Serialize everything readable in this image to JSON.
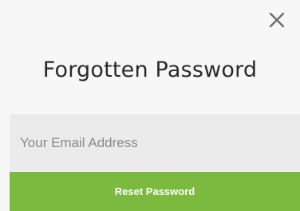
{
  "modal": {
    "close_icon": "close-icon",
    "title": "Forgotten Password",
    "email_placeholder": "Your Email Address",
    "email_value": "",
    "submit_label": "Reset Password"
  },
  "colors": {
    "accent_green": "#7cba3f",
    "modal_background": "#f7f7f7",
    "input_background": "#ebebeb",
    "title_text": "#2a2a2a",
    "close_icon": "#6d6d6d"
  }
}
